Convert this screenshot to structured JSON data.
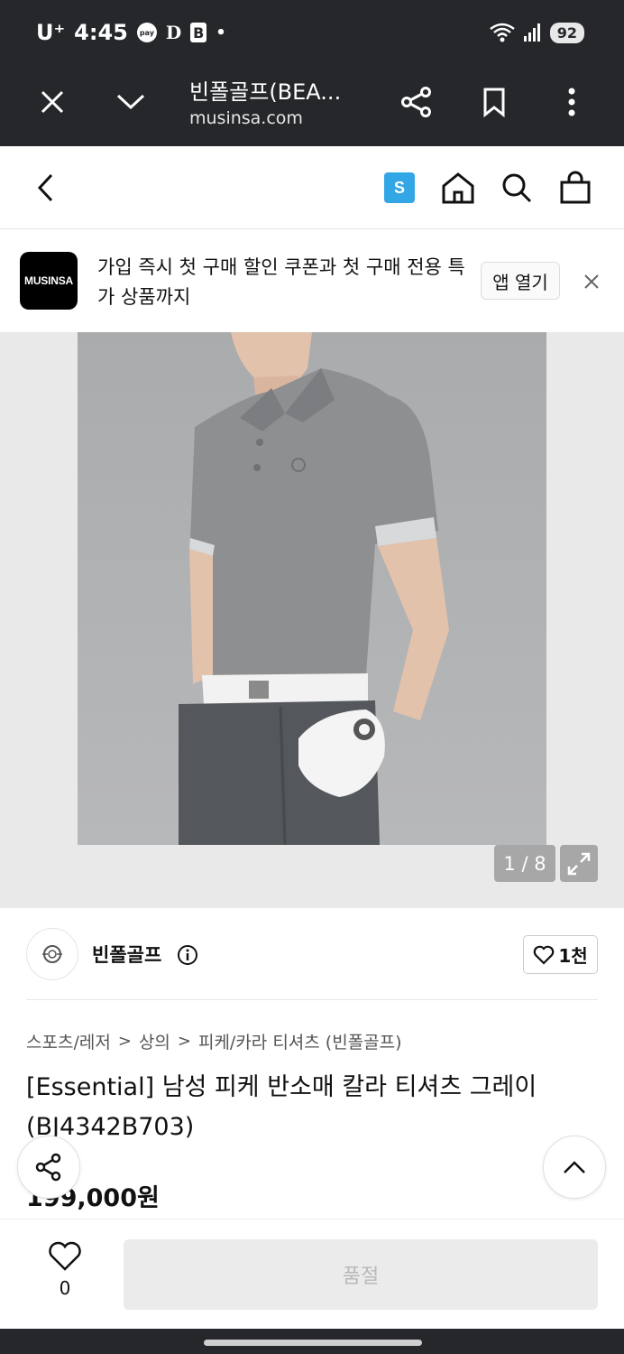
{
  "status_bar": {
    "carrier": "U⁺",
    "time": "4:45",
    "pay_label": "pay",
    "d_label": "D",
    "b_label": "B",
    "dot": "•",
    "battery": "92"
  },
  "browser": {
    "title": "빈폴골프(BEA...",
    "url": "musinsa.com"
  },
  "header": {
    "s_badge": "S"
  },
  "banner": {
    "logo_text": "MUSINSA",
    "message": "가입 즉시 첫 구매 할인 쿠폰과 첫 구매 전용 특가 상품까지",
    "open_button": "앱 열기"
  },
  "gallery": {
    "counter": "1 / 8"
  },
  "brand": {
    "name": "빈폴골프",
    "likes": "1천"
  },
  "product": {
    "breadcrumb": [
      "스포츠/레저",
      "상의",
      "피케/카라 티셔츠 (빈폴골프)"
    ],
    "breadcrumb_sep": ">",
    "title": "[Essential] 남성 피케 반소매 칼라 티셔츠 그레이 (BJ4342B703)",
    "price": "199,000원"
  },
  "bottom": {
    "wish_count": "0",
    "buy_button": "품절"
  },
  "colors": {
    "dark_bar": "#25272b",
    "s_badge": "#33a7e6",
    "soldout_bg": "#ebebeb",
    "soldout_text": "#b9b9b9"
  },
  "icons": [
    "close-icon",
    "chevron-down-icon",
    "share-icon",
    "bookmark-icon",
    "more-vert-icon",
    "back-icon",
    "home-icon",
    "search-icon",
    "shopping-bag-icon",
    "expand-icon",
    "info-icon",
    "heart-icon",
    "chevron-up-icon"
  ]
}
